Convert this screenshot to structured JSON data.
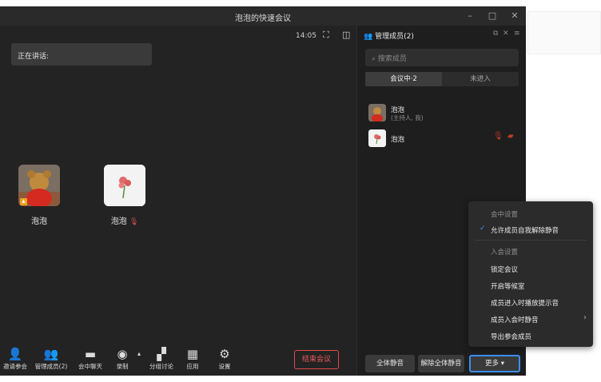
{
  "window": {
    "title": "泡泡的快速会议"
  },
  "video": {
    "time": "14:05",
    "speaking_label": "正在讲话:",
    "participants": [
      {
        "name": "泡泡"
      },
      {
        "name": "泡泡"
      }
    ]
  },
  "toolbar": {
    "items": [
      {
        "label": "邀请参会",
        "icon": "invite-icon"
      },
      {
        "label": "管理成员(2)",
        "icon": "members-icon"
      },
      {
        "label": "会中聊天",
        "icon": "chat-icon"
      },
      {
        "label": "录制",
        "icon": "record-icon"
      },
      {
        "label": "分组讨论",
        "icon": "breakout-icon"
      },
      {
        "label": "应用",
        "icon": "apps-icon"
      },
      {
        "label": "设置",
        "icon": "settings-icon"
      }
    ],
    "end_label": "结束会议"
  },
  "panel": {
    "title": "管理成员(2)",
    "search_placeholder": "搜索成员",
    "tabs": [
      {
        "label": "会议中·2",
        "active": true
      },
      {
        "label": "未进入",
        "active": false
      }
    ],
    "members": [
      {
        "name": "泡泡",
        "role": "(主持人, 我)"
      },
      {
        "name": "泡泡",
        "role": ""
      }
    ],
    "mute_all_label": "全体静音",
    "unmute_all_label": "解除全体静音",
    "more_label": "更多 ▾"
  },
  "menu": {
    "section1": "会中设置",
    "allow_unmute": "允许成员自我解除静音",
    "section2": "入会设置",
    "lock": "锁定会议",
    "waiting_room": "开启等候室",
    "join_sound": "成员进入时播放提示音",
    "mute_on_join": "成员入会时静音",
    "export": "导出参会成员"
  },
  "colors": {
    "accent": "#3b8ff0",
    "danger": "#e04b4b"
  }
}
